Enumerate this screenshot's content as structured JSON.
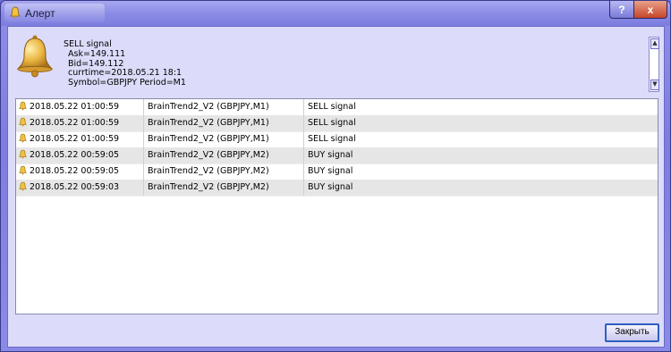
{
  "window": {
    "title": "Алерт",
    "help_label": "?",
    "close_label": "x"
  },
  "message": {
    "line1": "SELL signal",
    "line2": "Ask=149.111",
    "line3": "Bid=149.112",
    "line4": "currtime=2018.05.21 18:1",
    "line5": "Symbol=GBPJPY Period=M1"
  },
  "alerts": [
    {
      "time": "2018.05.22 01:00:59",
      "source": "BrainTrend2_V2 (GBPJPY,M1)",
      "message": "SELL signal"
    },
    {
      "time": "2018.05.22 01:00:59",
      "source": "BrainTrend2_V2 (GBPJPY,M1)",
      "message": "SELL signal"
    },
    {
      "time": "2018.05.22 01:00:59",
      "source": "BrainTrend2_V2 (GBPJPY,M1)",
      "message": "SELL signal"
    },
    {
      "time": "2018.05.22 00:59:05",
      "source": "BrainTrend2_V2 (GBPJPY,M2)",
      "message": "BUY signal"
    },
    {
      "time": "2018.05.22 00:59:05",
      "source": "BrainTrend2_V2 (GBPJPY,M2)",
      "message": "BUY signal"
    },
    {
      "time": "2018.05.22 00:59:03",
      "source": "BrainTrend2_V2 (GBPJPY,M2)",
      "message": "BUY signal"
    }
  ],
  "footer": {
    "close_button_label": "Закрыть"
  },
  "icons": {
    "bell": "bell-icon",
    "alert_row": "bell-icon"
  },
  "colors": {
    "title_bar": "#8b8be6",
    "client_bg": "#dcdcfa",
    "close_button_red": "#c6452a",
    "focus_border": "#2f5fbf"
  }
}
